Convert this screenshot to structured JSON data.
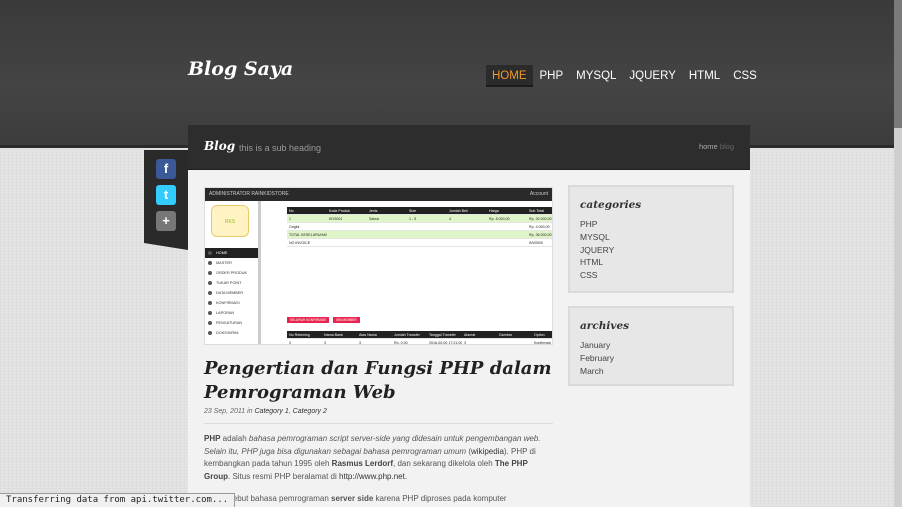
{
  "site": {
    "logo": "Blog Saya"
  },
  "nav": [
    "HOME",
    "PHP",
    "MYSQL",
    "JQUERY",
    "HTML",
    "CSS"
  ],
  "subheader": {
    "title": "Blog",
    "subtitle": "this is a sub heading",
    "crumb_home": "home",
    "crumb_current": "blog"
  },
  "social": [
    {
      "icon": "facebook-icon",
      "glyph": "f",
      "color": "#3b5998"
    },
    {
      "icon": "twitter-icon",
      "glyph": "t",
      "color": "#33ccff"
    },
    {
      "icon": "google-plus-icon",
      "glyph": "+",
      "color": "#777777"
    }
  ],
  "screenshot": {
    "topbar": "ADMINISTRATOR RAINKIDSTORE",
    "account": "Account",
    "logo_text": "RKS",
    "menu": [
      "HOME",
      "MASTER",
      "ORDER PRODUK",
      "TUKAR POINT",
      "DATA MEMBER",
      "KONFIRMASI",
      "LAPORAN",
      "PENGATURAN",
      "DOKS/KIRIM"
    ],
    "table1": {
      "headers": [
        "No",
        "Kode Produk",
        "Jenis",
        "Size",
        "Jumlah Beli",
        "Harga",
        "Sub Total"
      ],
      "rows": [
        [
          "1",
          "KDS001",
          "Sabuk",
          "1 - 5",
          "4",
          "Rp. 8.000,00",
          "Rp. 32.000,00"
        ],
        [
          "Ongkir",
          "",
          "",
          "",
          "",
          "",
          "Rp. 4.000,00"
        ],
        [
          "TOTAL KESELURUHAN",
          "",
          "",
          "",
          "",
          "",
          "Rp. 36.000,00"
        ],
        [
          "NO INVOICE",
          "",
          "",
          "",
          "",
          "",
          "INV0000"
        ]
      ]
    },
    "buttons": [
      "SELURUH KONFIRMASI",
      "SIM MEMBER"
    ],
    "table2": {
      "headers": [
        "No Rekening",
        "Nama Bank",
        "Atas Nama",
        "Jumlah Transfer",
        "Tanggal Transfer",
        "Alamat",
        "Gambar",
        "Option"
      ],
      "row": [
        "3",
        "3",
        "3",
        "Rp. 0.00",
        "2016-00-00 17:21:00",
        "3",
        "",
        "Konfirmasi"
      ]
    }
  },
  "post": {
    "title": "Pengertian dan Fungsi PHP dalam Pemrograman Web",
    "date": "23 Sep, 2011",
    "in_word": "in",
    "category1": "Category 1",
    "category2": "Category 2",
    "p1_b1": "PHP",
    "p1_t1": " adalah ",
    "p1_e1": "bahasa pemrograman script server-side yang didesain untuk pengembangan web. Selain itu, PHP juga bisa digunakan sebagai bahasa pemrograman umum",
    "p1_t2": " (",
    "p1_link1": "wikipedia",
    "p1_t3": "). PHP di kembangkan pada tahun 1995 oleh ",
    "p1_b2": "Rasmus Lerdorf",
    "p1_t4": ", dan sekarang dikelola oleh ",
    "p1_b3": "The PHP Group",
    "p1_t5": ". Situs resmi PHP beralamat di ",
    "p1_link2": "http://www.php.net",
    "p1_t6": ".",
    "p2_t1": "PHP disebut bahasa pemrograman ",
    "p2_b1": "server side",
    "p2_t2": " karena PHP diproses pada komputer"
  },
  "sidebar": {
    "categories": {
      "title": "categories",
      "items": [
        "PHP",
        "MYSQL",
        "JQUERY",
        "HTML",
        "CSS"
      ]
    },
    "archives": {
      "title": "archives",
      "items": [
        "January",
        "February",
        "March"
      ]
    }
  },
  "status": "Transferring data from api.twitter.com..."
}
